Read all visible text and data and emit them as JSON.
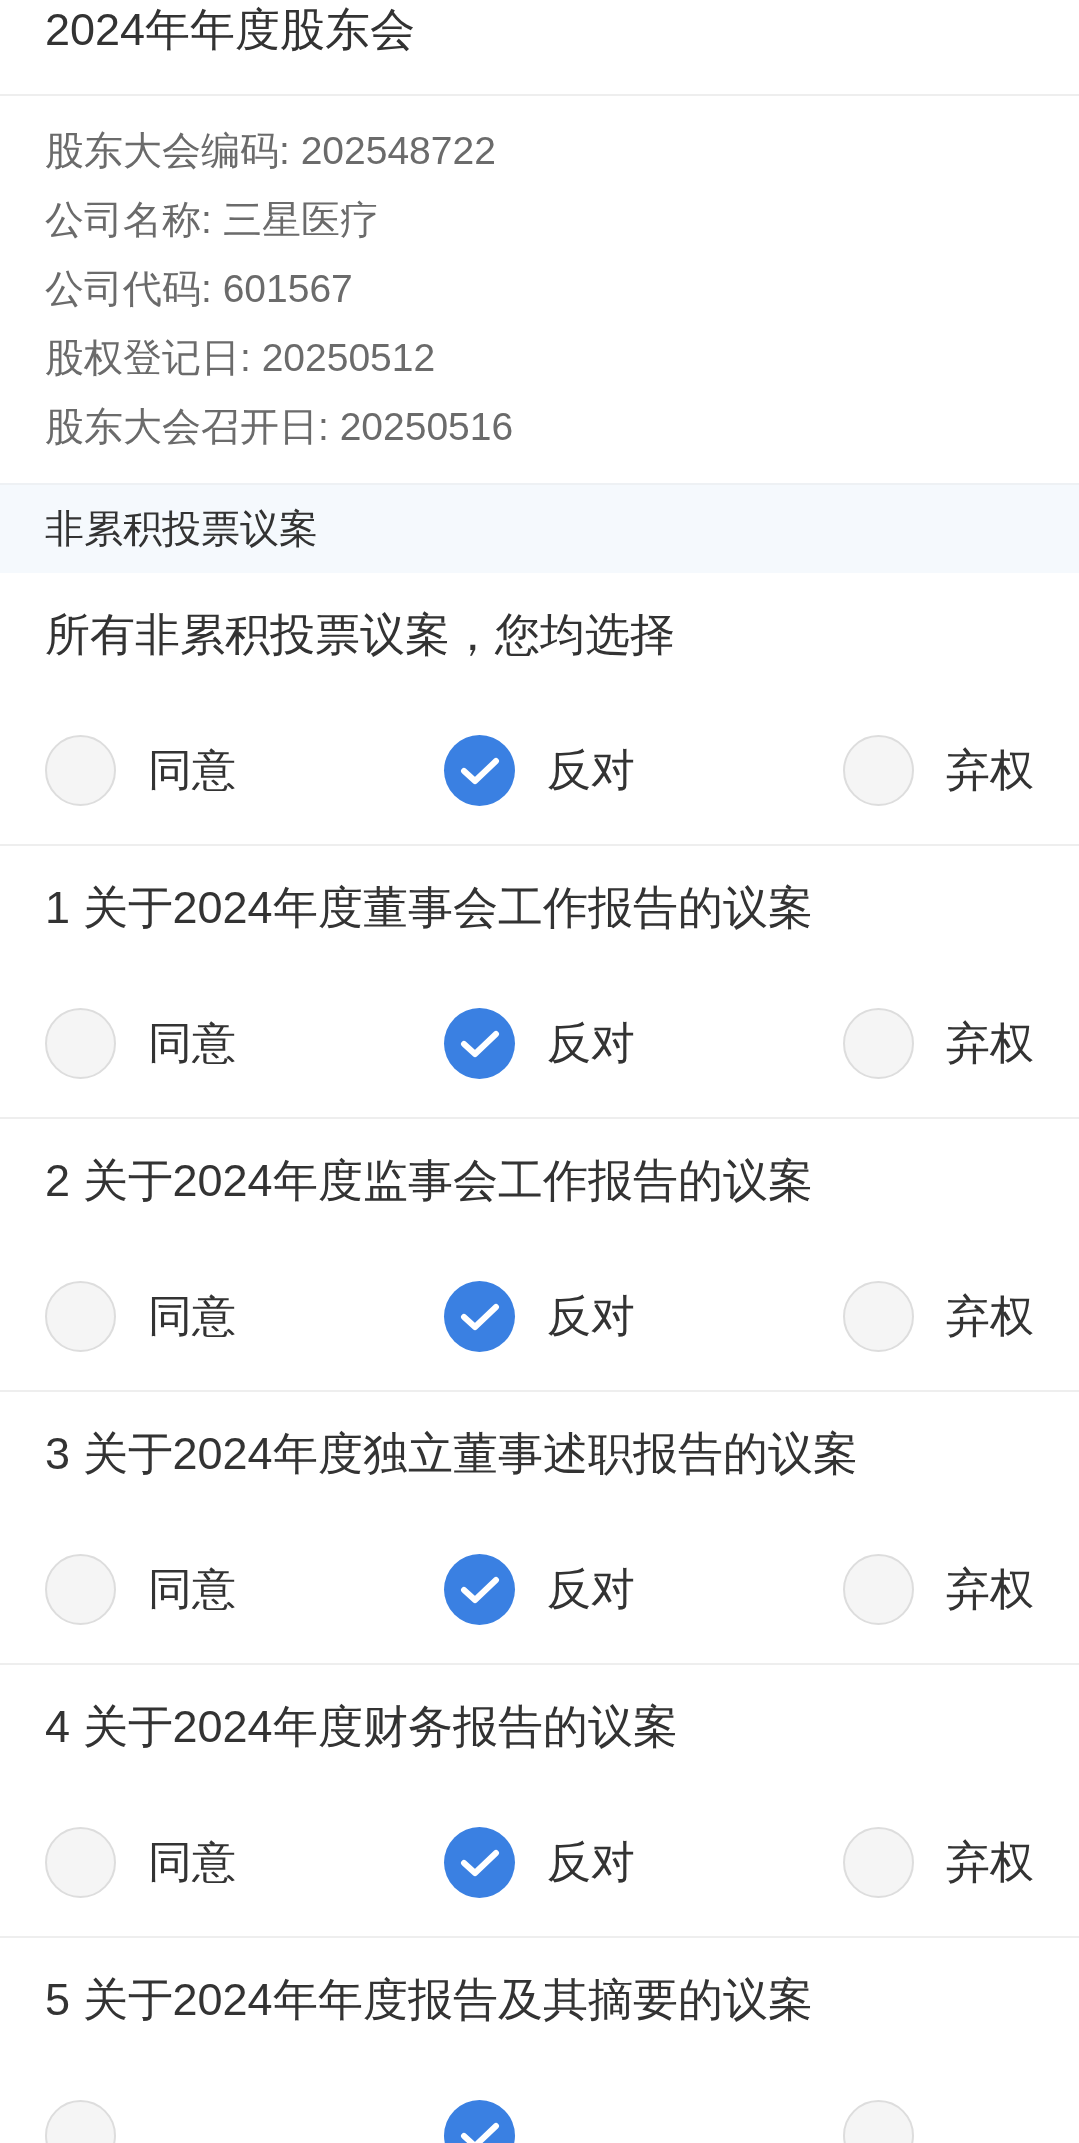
{
  "title": "2024年年度股东会",
  "info_lines": [
    "股东大会编码: 202548722",
    "公司名称: 三星医疗",
    "公司代码: 601567",
    "股权登记日: 20250512",
    "股东大会召开日: 20250516"
  ],
  "section": {
    "title": "非累积投票议案"
  },
  "proposals": [
    {
      "text": "所有非累积投票议案，您均选择",
      "options": [
        {
          "label": "同意",
          "selected": false
        },
        {
          "label": "反对",
          "selected": true
        },
        {
          "label": "弃权",
          "selected": false
        }
      ]
    },
    {
      "text": "1 关于2024年度董事会工作报告的议案",
      "options": [
        {
          "label": "同意",
          "selected": false
        },
        {
          "label": "反对",
          "selected": true
        },
        {
          "label": "弃权",
          "selected": false
        }
      ]
    },
    {
      "text": "2 关于2024年度监事会工作报告的议案",
      "options": [
        {
          "label": "同意",
          "selected": false
        },
        {
          "label": "反对",
          "selected": true
        },
        {
          "label": "弃权",
          "selected": false
        }
      ]
    },
    {
      "text": "3 关于2024年度独立董事述职报告的议案",
      "options": [
        {
          "label": "同意",
          "selected": false
        },
        {
          "label": "反对",
          "selected": true
        },
        {
          "label": "弃权",
          "selected": false
        }
      ]
    },
    {
      "text": "4 关于2024年度财务报告的议案",
      "options": [
        {
          "label": "同意",
          "selected": false
        },
        {
          "label": "反对",
          "selected": true
        },
        {
          "label": "弃权",
          "selected": false
        }
      ]
    },
    {
      "text": "5 关于2024年年度报告及其摘要的议案",
      "options": [
        {
          "selected": false
        },
        {
          "selected": true
        },
        {
          "selected": false
        }
      ]
    }
  ]
}
